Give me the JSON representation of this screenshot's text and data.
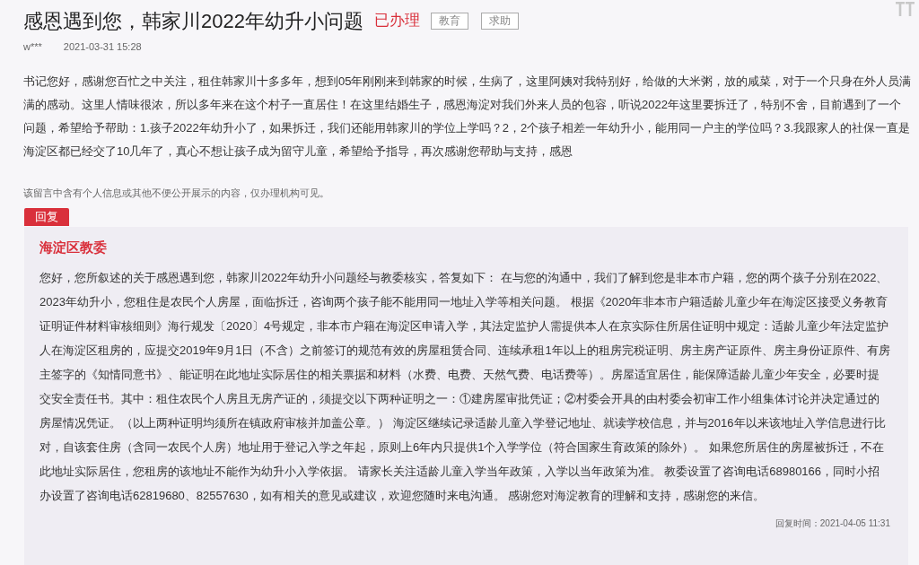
{
  "post": {
    "title": "感恩遇到您，韩家川2022年幼升小问题",
    "status": "已办理",
    "tags": [
      "教育",
      "求助"
    ],
    "author": "w***",
    "time": "2021-03-31 15:28",
    "body": "书记您好，感谢您百忙之中关注，租住韩家川十多多年，想到05年刚刚来到韩家的时候，生病了，这里阿姨对我特别好，给做的大米粥，放的咸菜，对于一个只身在外人员满满的感动。这里人情味很浓，所以多年来在这个村子一直居住！在这里结婚生子，感恩海淀对我们外来人员的包容，听说2022年这里要拆迁了，特别不舍，目前遇到了一个问题，希望给予帮助：1.孩子2022年幼升小了，如果拆迁，我们还能用韩家川的学位上学吗？2，2个孩子相差一年幼升小，能用同一户主的学位吗？3.我跟家人的社保一直是海淀区都已经交了10几年了，真心不想让孩子成为留守儿童，希望给予指导，再次感谢您帮助与支持，感恩",
    "privacy_note": "该留言中含有个人信息或其他不便公开展示的内容，仅办理机构可见。"
  },
  "reply_tab": "回复",
  "reply": {
    "org": "海淀区教委",
    "body": "您好，您所叙述的关于感恩遇到您，韩家川2022年幼升小问题经与教委核实，答复如下： 在与您的沟通中，我们了解到您是非本市户籍，您的两个孩子分别在2022、2023年幼升小，您租住是农民个人房屋，面临拆迁，咨询两个孩子能不能用同一地址入学等相关问题。 根据《2020年非本市户籍适龄儿童少年在海淀区接受义务教育证明证件材料审核细则》海行规发〔2020〕4号规定，非本市户籍在海淀区申请入学，其法定监护人需提供本人在京实际住所居住证明中规定：适龄儿童少年法定监护人在海淀区租房的，应提交2019年9月1日（不含）之前签订的规范有效的房屋租赁合同、连续承租1年以上的租房完税证明、房主房产证原件、房主身份证原件、有房主签字的《知情同意书》、能证明在此地址实际居住的相关票据和材料（水费、电费、天然气费、电话费等）。房屋适宜居住，能保障适龄儿童少年安全，必要时提交安全责任书。其中：租住农民个人房且无房产证的，须提交以下两种证明之一：①建房屋审批凭证；②村委会开具的由村委会初审工作小组集体讨论并决定通过的房屋情况凭证。（以上两种证明均须所在镇政府审核并加盖公章。） 海淀区继续记录适龄儿童入学登记地址、就读学校信息，并与2016年以来该地址入学信息进行比对，自该套住房（含同一农民个人房）地址用于登记入学之年起，原则上6年内只提供1个入学学位（符合国家生育政策的除外）。 如果您所居住的房屋被拆迁，不在此地址实际居住，您租房的该地址不能作为幼升小入学依据。 请家长关注适龄儿童入学当年政策，入学以当年政策为准。 教委设置了咨询电话68980166，同时小招办设置了咨询电话62819680、82557630，如有相关的意见或建议，欢迎您随时来电沟通。 感谢您对海淀教育的理解和支持，感谢您的来信。",
    "time": "回复时间：2021-04-05 11:31"
  }
}
